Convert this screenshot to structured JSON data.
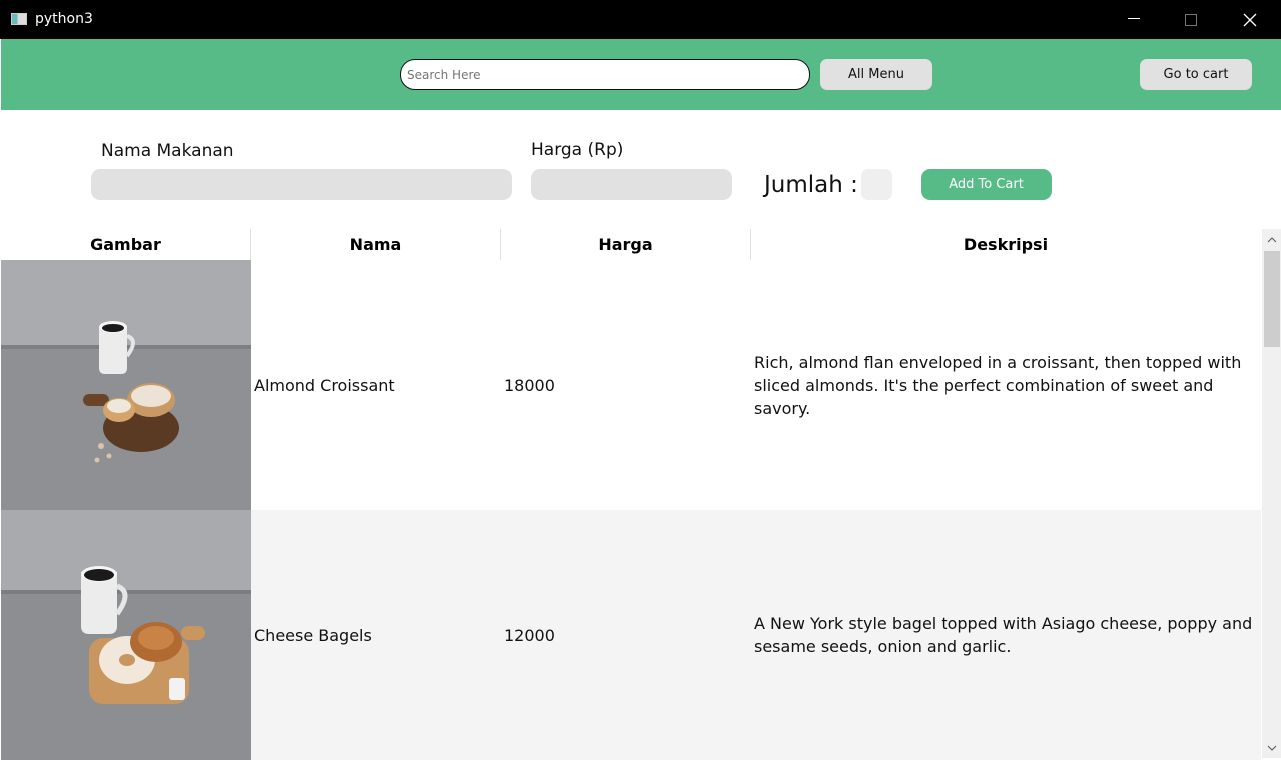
{
  "window": {
    "title": "python3"
  },
  "toolbar": {
    "search_placeholder": "Search Here",
    "all_menu_label": "All Menu",
    "go_to_cart_label": "Go to cart"
  },
  "form": {
    "nama_label": "Nama Makanan",
    "harga_label": "Harga (Rp)",
    "jumlah_label": "Jumlah :",
    "add_to_cart_label": "Add To Cart"
  },
  "table": {
    "headers": [
      "Gambar",
      "Nama",
      "Harga",
      "Deskripsi"
    ],
    "rows": [
      {
        "nama": "Almond Croissant",
        "harga": "18000",
        "deskripsi": "Rich, almond flan enveloped in a croissant, then topped with sliced almonds. It's the perfect combination of sweet and savory."
      },
      {
        "nama": "Cheese Bagels",
        "harga": "12000",
        "deskripsi": "A New York style bagel topped with Asiago cheese, poppy and sesame seeds, onion and garlic."
      }
    ]
  },
  "colors": {
    "accent": "#57bb87",
    "field": "#e1e1e1",
    "titlebar": "#000000"
  }
}
